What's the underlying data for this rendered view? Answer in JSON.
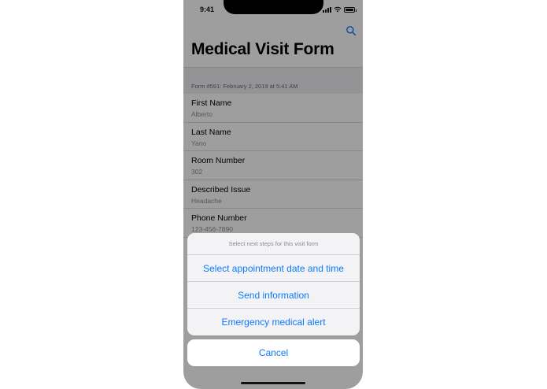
{
  "status_bar": {
    "time": "9:41"
  },
  "nav": {
    "title": "Medical Visit Form"
  },
  "form": {
    "header": "Form #591: February 2, 2019 at 5:41 AM",
    "fields": [
      {
        "label": "First Name",
        "value": "Alberto"
      },
      {
        "label": "Last Name",
        "value": "Yano"
      },
      {
        "label": "Room Number",
        "value": "302"
      },
      {
        "label": "Described Issue",
        "value": "Headache"
      },
      {
        "label": "Phone Number",
        "value": "123-456-7890"
      }
    ]
  },
  "action_sheet": {
    "title": "Select next steps for this visit form",
    "actions": [
      "Select appointment date and time",
      "Send information",
      "Emergency medical alert"
    ],
    "cancel_label": "Cancel"
  },
  "colors": {
    "accent": "#0a7aff",
    "dim_overlay": "rgba(0,0,0,0.38)",
    "sheet_bg": "#f3f3f5"
  },
  "icons": {
    "search": "search-icon",
    "signal": "cellular-signal-icon",
    "wifi": "wifi-icon",
    "battery": "battery-icon"
  }
}
